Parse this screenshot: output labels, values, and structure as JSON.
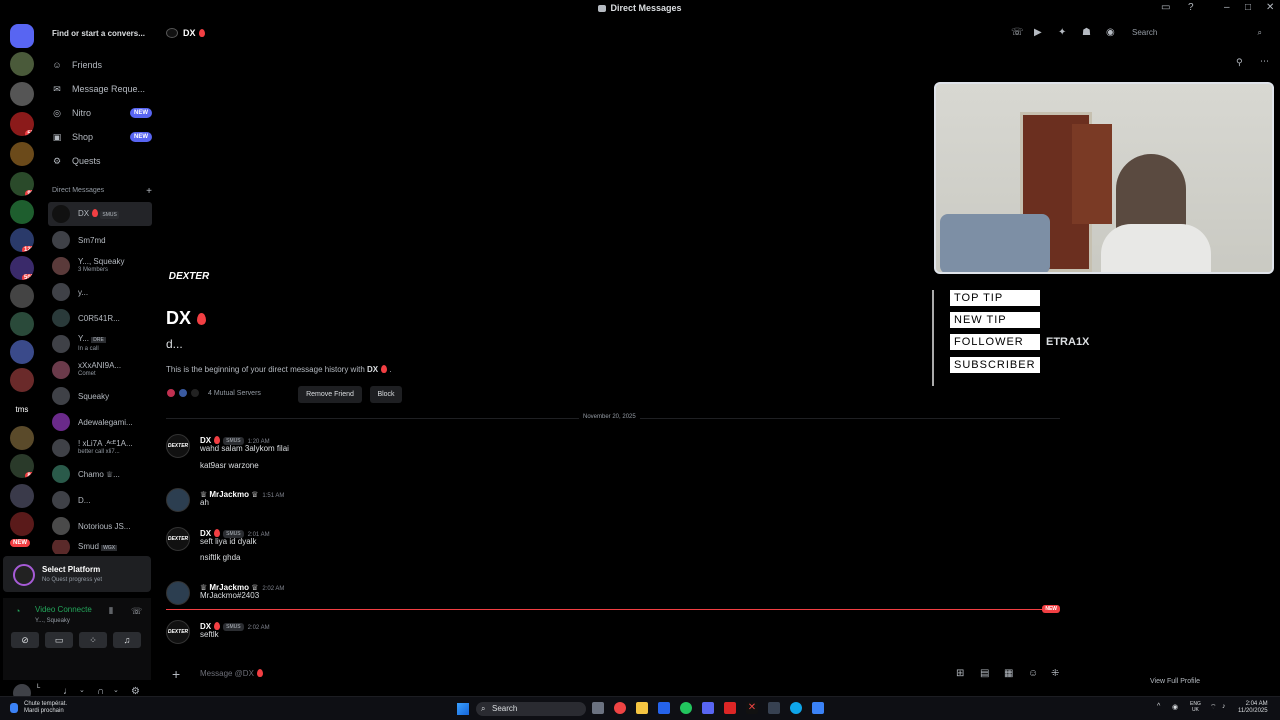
{
  "window": {
    "title": "Direct Messages"
  },
  "server_badges": [
    "55",
    "93",
    "128",
    "507",
    "84",
    "NEW"
  ],
  "server_text": "tms",
  "sidebar": {
    "find_label": "Find or start a convers...",
    "nav": [
      {
        "label": "Friends",
        "icon": "friends-icon"
      },
      {
        "label": "Message Reque...",
        "icon": "mail-icon"
      },
      {
        "label": "Nitro",
        "icon": "nitro-icon",
        "badge": "NEW"
      },
      {
        "label": "Shop",
        "icon": "shop-icon",
        "badge": "NEW"
      },
      {
        "label": "Quests",
        "icon": "quests-icon"
      }
    ],
    "dm_header": "Direct Messages",
    "dms": [
      {
        "name": "DX",
        "sub": ""
      },
      {
        "name": "Sm7md",
        "sub": ""
      },
      {
        "name": "Y..., Squeaky",
        "sub": "3 Members"
      },
      {
        "name": "y...",
        "sub": ""
      },
      {
        "name": "C0R541R...",
        "sub": ""
      },
      {
        "name": "Y...",
        "tag": "DRE",
        "sub": "In a call"
      },
      {
        "name": "xXxANI9A...",
        "sub": "Comet"
      },
      {
        "name": "Squeaky",
        "sub": ""
      },
      {
        "name": "Adewalegami...",
        "sub": ""
      },
      {
        "name": "! xLi7A .ᴬᶜᴱ1A...",
        "sub": "better call xli7..."
      },
      {
        "name": "Chamo ♕...",
        "sub": ""
      },
      {
        "name": "D...",
        "sub": ""
      },
      {
        "name": "Notorious JS...",
        "sub": ""
      },
      {
        "name": "Smud",
        "tag": "WGX",
        "sub": ""
      }
    ],
    "quest": {
      "title": "Select Platform",
      "subtitle": "No Quest progress yet"
    },
    "voice": {
      "status": "Video Connecte",
      "channel": "Y..., Squeaky"
    },
    "user": {
      "name": "L"
    }
  },
  "header": {
    "name": "DX",
    "search_placeholder": "Search"
  },
  "intro": {
    "avatar_text": "DEXTER",
    "name": "DX",
    "username": "d...",
    "history_text": "This is the beginning of your direct message history with ",
    "history_name": "DX",
    "history_end": ".",
    "mutual": "4 Mutual Servers",
    "remove_friend": "Remove Friend",
    "block": "Block"
  },
  "date_divider": "November 20, 2025",
  "messages": [
    {
      "author": "DX",
      "tag": "SMUS",
      "time": "1:20 AM",
      "line1": "wahd salam 3alykom filai",
      "line2": "kat9asr warzone"
    },
    {
      "author": "♕ MrJackmo ♕",
      "tag": "",
      "time": "1:51 AM",
      "line1": "ah",
      "line2": ""
    },
    {
      "author": "DX",
      "tag": "SMUS",
      "time": "2:01 AM",
      "line1": "seft liya id dyalk",
      "line2": "nsiftlk ghda"
    },
    {
      "author": "♕ MrJackmo ♕",
      "tag": "",
      "time": "2:02 AM",
      "line1": "MrJackmo#2403",
      "line2": ""
    },
    {
      "author": "DX",
      "tag": "SMUS",
      "time": "2:02 AM",
      "line1": "seftlk",
      "line2": ""
    }
  ],
  "new_marker": "NEW",
  "composer": {
    "placeholder": "Message @DX"
  },
  "overlay": {
    "alerts": [
      "TOP TIP",
      "NEW TIP",
      "FOLLOWER",
      "SUBSCRIBER"
    ],
    "follower_name": "ETRA1X"
  },
  "view_profile": "View Full Profile",
  "taskbar": {
    "weather": "Chute températ.",
    "weather_sub": "Mardi prochain",
    "search": "Search",
    "lang": "ENG",
    "lang_sub": "UK",
    "time": "2:04 AM",
    "date": "11/20/2025"
  },
  "colors": {
    "accent": "#5865f2",
    "danger": "#f23f43",
    "online": "#23a55a"
  }
}
